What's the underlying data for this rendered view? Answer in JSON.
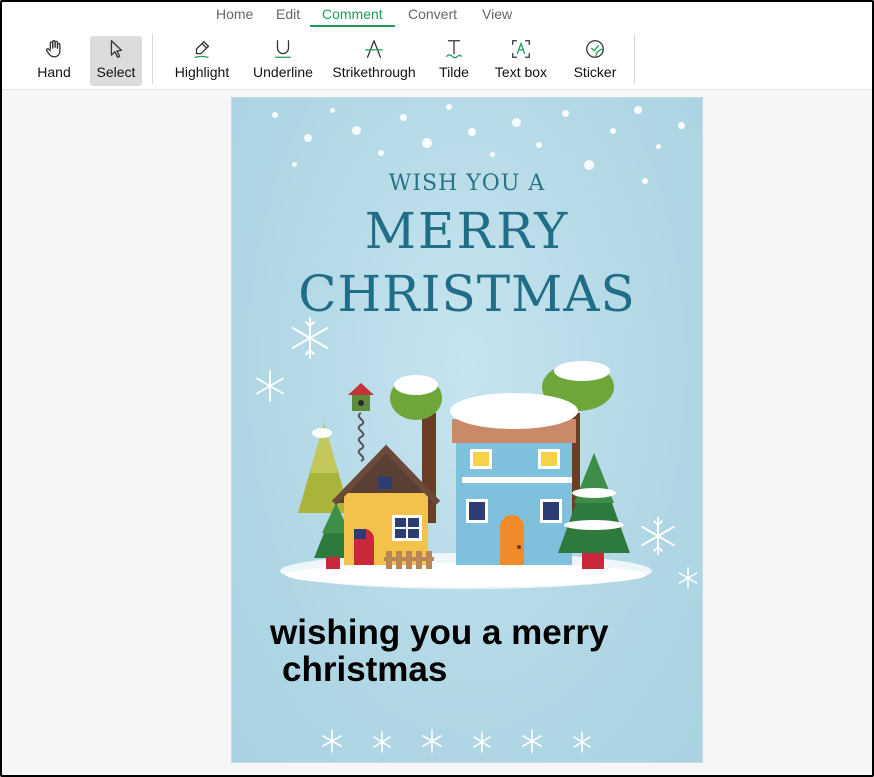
{
  "menu": {
    "tabs": [
      {
        "label": "Home"
      },
      {
        "label": "Edit"
      },
      {
        "label": "Comment"
      },
      {
        "label": "Convert"
      },
      {
        "label": "View"
      }
    ],
    "active": "Comment"
  },
  "toolbar": {
    "tools": [
      {
        "label": "Hand",
        "icon": "hand-icon"
      },
      {
        "label": "Select",
        "icon": "cursor-icon"
      },
      {
        "label": "Highlight",
        "icon": "highlighter-icon"
      },
      {
        "label": "Underline",
        "icon": "underline-icon"
      },
      {
        "label": "Strikethrough",
        "icon": "strikethrough-icon"
      },
      {
        "label": "Tilde",
        "icon": "tilde-icon"
      },
      {
        "label": "Text box",
        "icon": "text-box-icon"
      },
      {
        "label": "Sticker",
        "icon": "sticker-icon"
      }
    ],
    "selected": "Select"
  },
  "document": {
    "card": {
      "line1": "WISH YOU A",
      "line2": "MERRY",
      "line3": "CHRISTMAS"
    },
    "added_text": {
      "line1": "wishing you a merry",
      "line2": "christmas"
    }
  },
  "colors": {
    "accent": "#1e9e5a",
    "card_background": "#b3d8e6",
    "card_title": "#1f6d86"
  }
}
